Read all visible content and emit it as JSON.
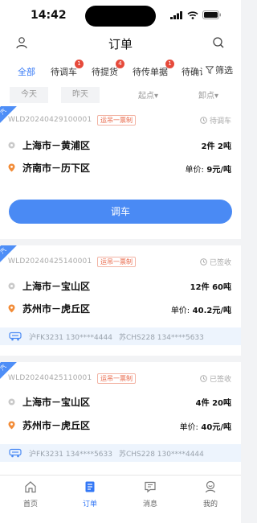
{
  "status_bar": {
    "time": "14:42"
  },
  "nav": {
    "title": "订单"
  },
  "tabs": [
    {
      "label": "全部",
      "badge": ""
    },
    {
      "label": "待调车",
      "badge": "1"
    },
    {
      "label": "待提货",
      "badge": "4"
    },
    {
      "label": "待传单据",
      "badge": "1"
    },
    {
      "label": "待确认",
      "badge": ""
    }
  ],
  "filter_label": "筛选",
  "date_filters": {
    "today": "今天",
    "yesterday": "昨天"
  },
  "dropdowns": {
    "origin": "起点▾",
    "destination": "卸点▾"
  },
  "orders": [
    {
      "corner_tag": "汽",
      "order_no": "WLD20240429100001",
      "tag": "运吊一票制",
      "status": "待调车",
      "origin": "上海市－黄浦区",
      "destination": "济南市－历下区",
      "quantity": "2件 2吨",
      "unit_price_label": "单价:",
      "unit_price": "9元/吨",
      "action": "调车"
    },
    {
      "corner_tag": "汽",
      "order_no": "WLD20240425140001",
      "tag": "运吊一票制",
      "status": "已签收",
      "origin": "上海市－宝山区",
      "destination": "苏州市－虎丘区",
      "quantity": "12件 60吨",
      "unit_price_label": "单价:",
      "unit_price": "40.2元/吨",
      "trucks": [
        "沪FK3231 130****4444",
        "苏CHS228 134****5633"
      ]
    },
    {
      "corner_tag": "汽",
      "order_no": "WLD20240425110001",
      "tag": "运吊一票制",
      "status": "已签收",
      "origin": "上海市－宝山区",
      "destination": "苏州市－虎丘区",
      "quantity": "4件 20吨",
      "unit_price_label": "单价:",
      "unit_price": "40元/吨",
      "trucks": [
        "沪FK3231 134****5633",
        "苏CHS228 130****4444"
      ]
    }
  ],
  "tabbar": [
    {
      "label": "首页",
      "icon": "home-icon"
    },
    {
      "label": "订单",
      "icon": "orders-icon"
    },
    {
      "label": "消息",
      "icon": "message-icon"
    },
    {
      "label": "我的",
      "icon": "profile-icon"
    }
  ],
  "colors": {
    "accent": "#3478f6",
    "badge": "#e64a3b",
    "tag": "#e8684a",
    "button": "#4a8af4"
  }
}
